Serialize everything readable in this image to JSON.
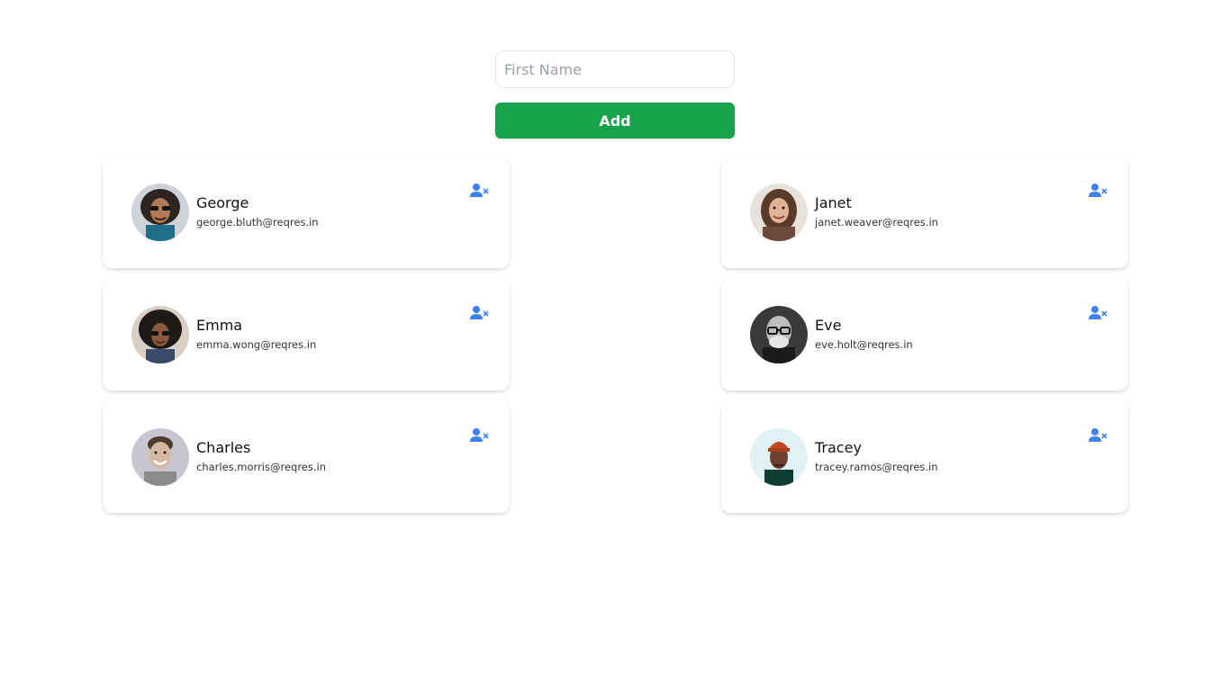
{
  "form": {
    "first_name_placeholder": "First Name",
    "first_name_value": "",
    "add_label": "Add"
  },
  "colors": {
    "accent": "#16a34a",
    "remove_icon": "#3b82f6"
  },
  "users": [
    {
      "name": "George",
      "email": "george.bluth@reqres.in",
      "avatar_icon": "avatar-photo"
    },
    {
      "name": "Janet",
      "email": "janet.weaver@reqres.in",
      "avatar_icon": "avatar-photo"
    },
    {
      "name": "Emma",
      "email": "emma.wong@reqres.in",
      "avatar_icon": "avatar-photo"
    },
    {
      "name": "Eve",
      "email": "eve.holt@reqres.in",
      "avatar_icon": "avatar-photo"
    },
    {
      "name": "Charles",
      "email": "charles.morris@reqres.in",
      "avatar_icon": "avatar-photo"
    },
    {
      "name": "Tracey",
      "email": "tracey.ramos@reqres.in",
      "avatar_icon": "avatar-photo"
    }
  ],
  "remove_icon": "user-remove-icon"
}
